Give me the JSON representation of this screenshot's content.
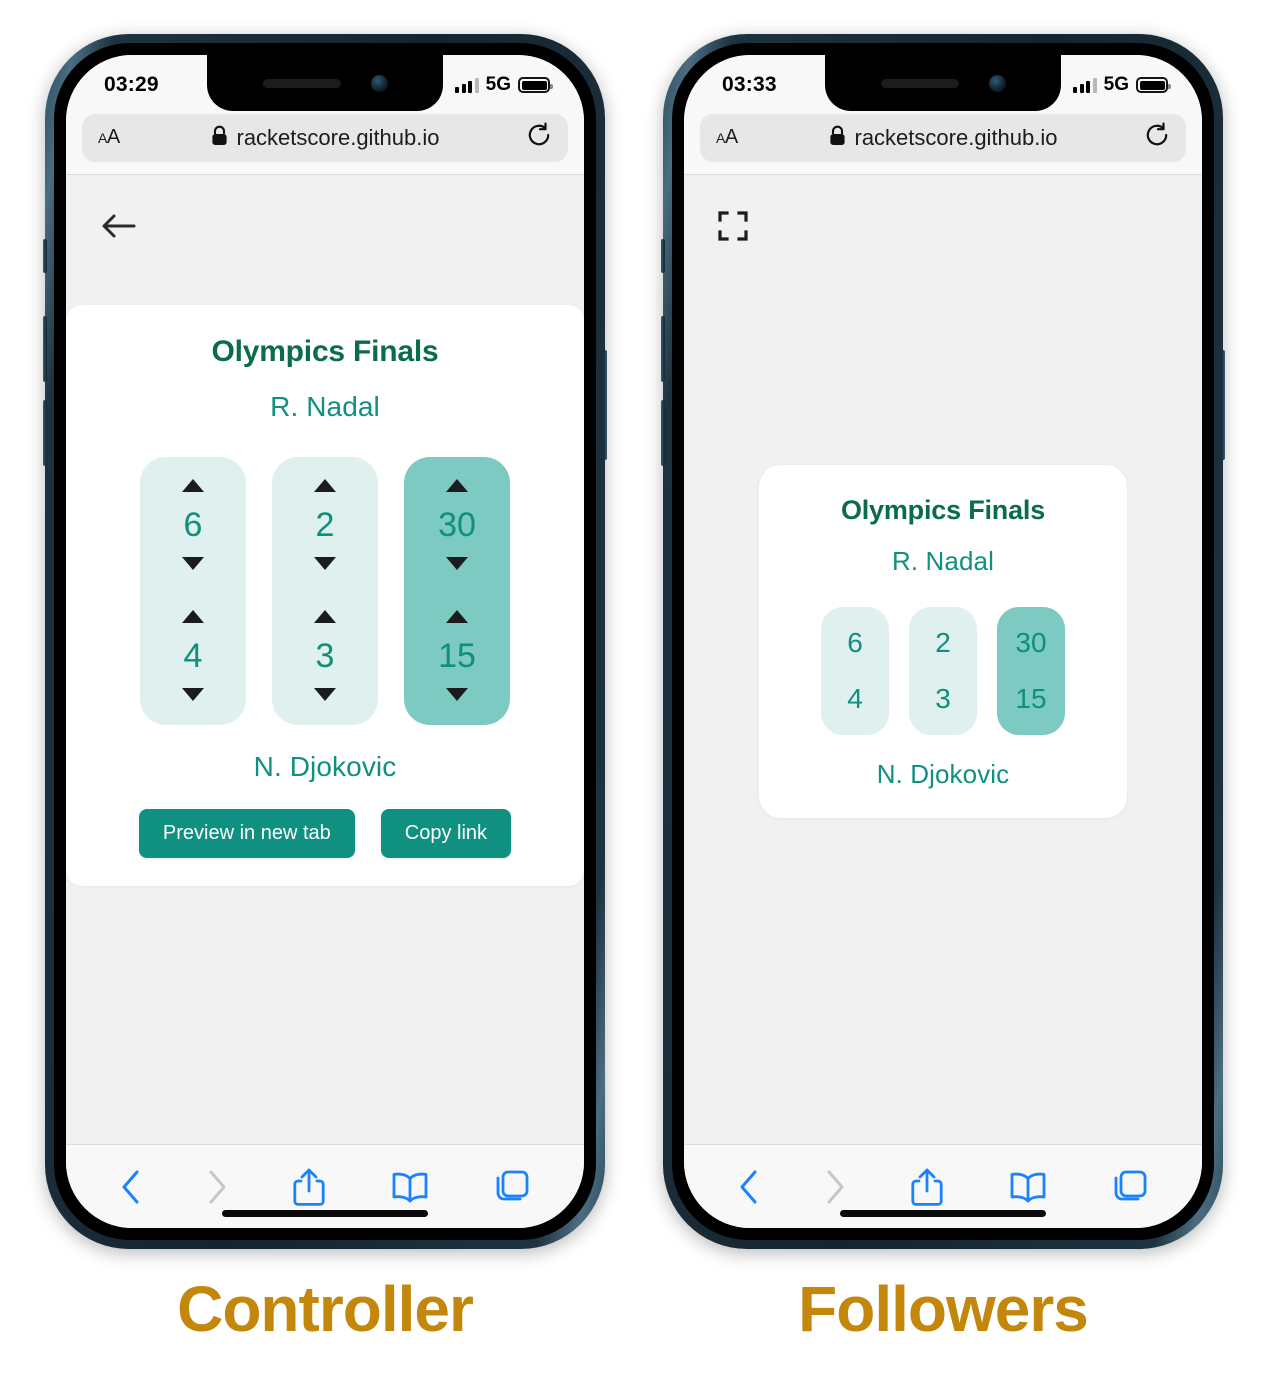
{
  "page_background": "#f1f1f1",
  "colors": {
    "brand_dark_green": "#0b6b4f",
    "brand_teal": "#0f9080",
    "score_light": "#dff0ee",
    "score_accent": "#7ccac2",
    "caption_gold": "#c2870b",
    "safari_blue": "#1a82ff"
  },
  "phones": [
    {
      "caption": "Controller",
      "status_bar": {
        "time": "03:29",
        "network": "5G",
        "signal_icon": "cellular-signal-icon",
        "battery_icon": "battery-full-icon"
      },
      "browser": {
        "text_size_label": "AA",
        "lock_icon": "lock-icon",
        "url": "racketscore.github.io",
        "reload_icon": "reload-icon"
      },
      "nav": {
        "back_icon": "back-arrow-icon"
      },
      "card": {
        "title": "Olympics Finals",
        "player_top": "R. Nadal",
        "player_bottom": "N. Djokovic",
        "columns": [
          {
            "accent": false,
            "top": "6",
            "bottom": "4"
          },
          {
            "accent": false,
            "top": "2",
            "bottom": "3"
          },
          {
            "accent": true,
            "top": "30",
            "bottom": "15"
          }
        ],
        "actions": [
          {
            "label": "Preview in new tab",
            "name": "preview-in-new-tab-button"
          },
          {
            "label": "Copy link",
            "name": "copy-link-button"
          }
        ]
      },
      "toolbar": [
        {
          "icon": "back-chevron-icon",
          "state": "enabled"
        },
        {
          "icon": "forward-chevron-icon",
          "state": "disabled"
        },
        {
          "icon": "share-icon",
          "state": "enabled"
        },
        {
          "icon": "bookmarks-book-icon",
          "state": "enabled"
        },
        {
          "icon": "tabs-icon",
          "state": "enabled"
        }
      ]
    },
    {
      "caption": "Followers",
      "status_bar": {
        "time": "03:33",
        "network": "5G",
        "signal_icon": "cellular-signal-icon",
        "battery_icon": "battery-full-icon"
      },
      "browser": {
        "text_size_label": "AA",
        "lock_icon": "lock-icon",
        "url": "racketscore.github.io",
        "reload_icon": "reload-icon"
      },
      "nav": {
        "fullscreen_icon": "fullscreen-expand-icon"
      },
      "card": {
        "title": "Olympics Finals",
        "player_top": "R. Nadal",
        "player_bottom": "N. Djokovic",
        "columns": [
          {
            "accent": false,
            "top": "6",
            "bottom": "4"
          },
          {
            "accent": false,
            "top": "2",
            "bottom": "3"
          },
          {
            "accent": true,
            "top": "30",
            "bottom": "15"
          }
        ]
      },
      "toolbar": [
        {
          "icon": "back-chevron-icon",
          "state": "enabled"
        },
        {
          "icon": "forward-chevron-icon",
          "state": "disabled"
        },
        {
          "icon": "share-icon",
          "state": "enabled"
        },
        {
          "icon": "bookmarks-book-icon",
          "state": "enabled"
        },
        {
          "icon": "tabs-icon",
          "state": "enabled"
        }
      ]
    }
  ]
}
